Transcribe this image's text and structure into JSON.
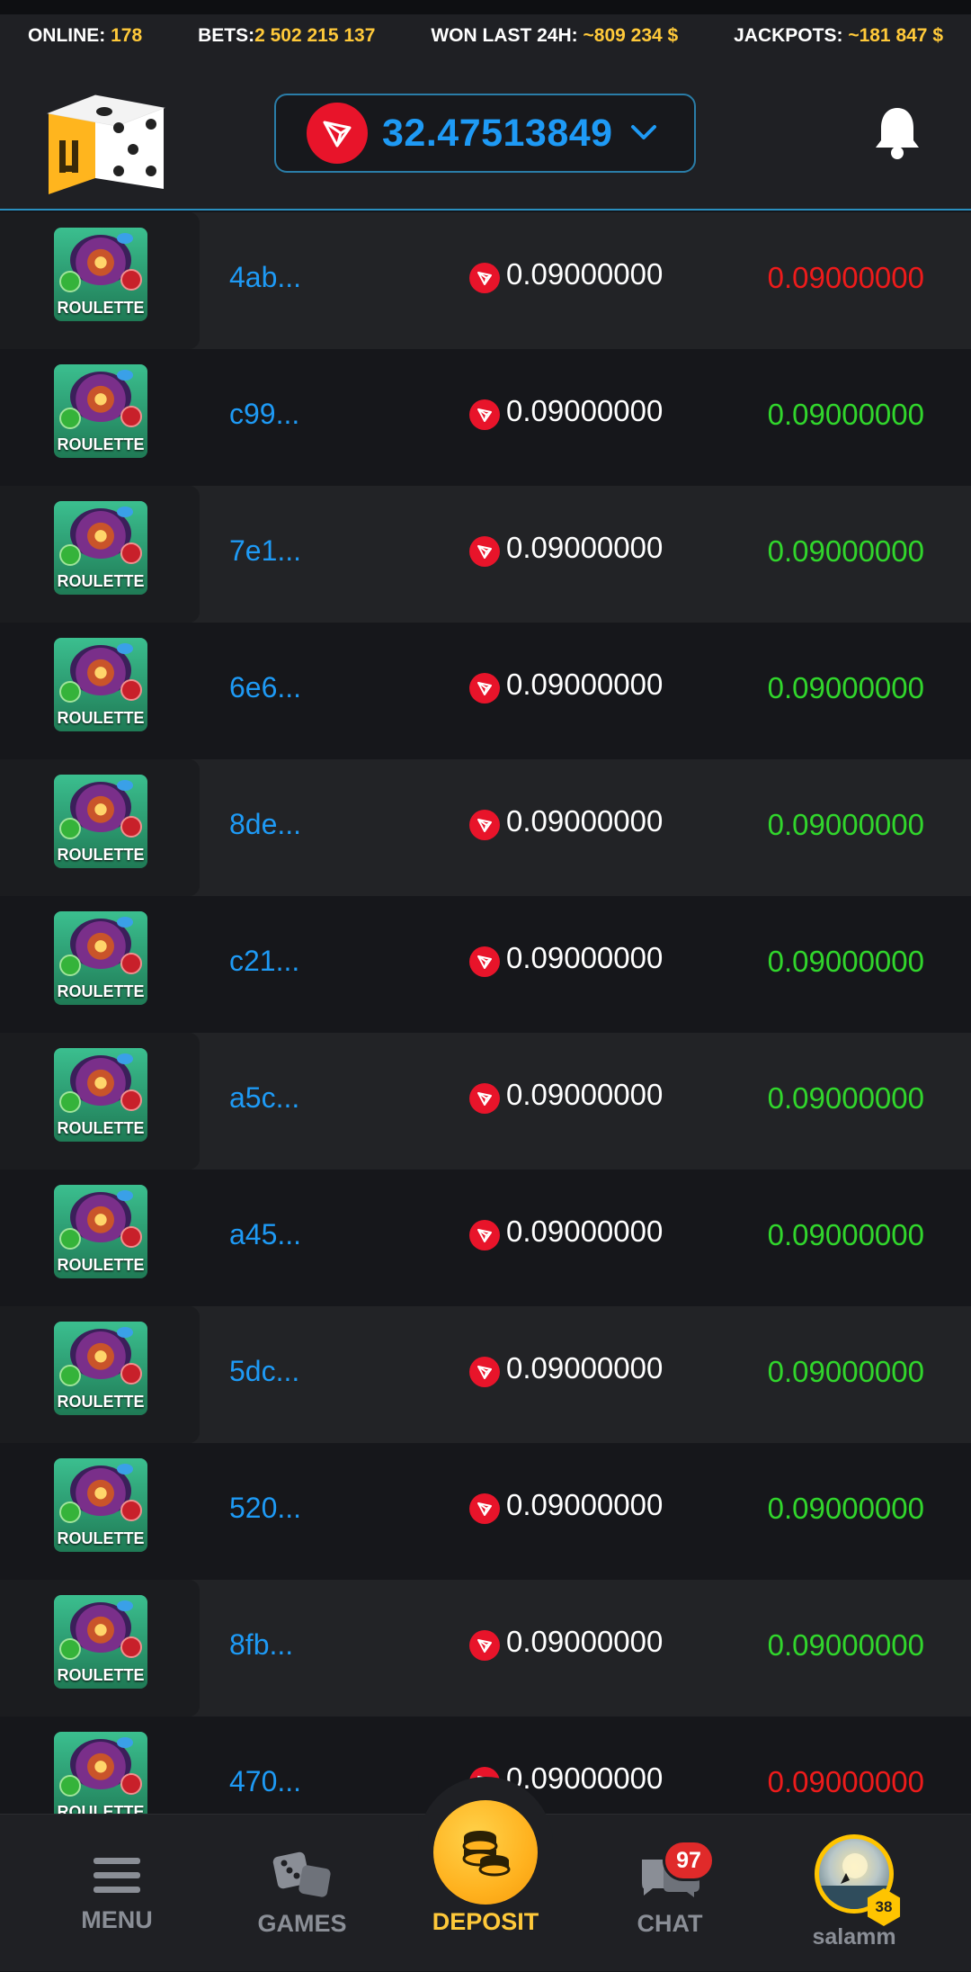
{
  "ticker": {
    "online_label": "ONLINE:",
    "online_value": "178",
    "bets_label": "BETS:",
    "bets_value": "2 502 215 137",
    "won_label": "WON LAST 24H:",
    "won_value": "~809 234 $",
    "jackpots_label": "JACKPOTS:",
    "jackpots_value": "~181 847 $"
  },
  "header": {
    "logo_icon": "dice-logo-icon",
    "balance": "32.47513849",
    "currency_icon": "tron-icon",
    "notification_icon": "bell-icon"
  },
  "bets": [
    {
      "game": "ROULETTE",
      "hash": "4ab...",
      "amount": "0.09000000",
      "profit": "0.09000000",
      "result": "loss"
    },
    {
      "game": "ROULETTE",
      "hash": "c99...",
      "amount": "0.09000000",
      "profit": "0.09000000",
      "result": "win"
    },
    {
      "game": "ROULETTE",
      "hash": "7e1...",
      "amount": "0.09000000",
      "profit": "0.09000000",
      "result": "win"
    },
    {
      "game": "ROULETTE",
      "hash": "6e6...",
      "amount": "0.09000000",
      "profit": "0.09000000",
      "result": "win"
    },
    {
      "game": "ROULETTE",
      "hash": "8de...",
      "amount": "0.09000000",
      "profit": "0.09000000",
      "result": "win"
    },
    {
      "game": "ROULETTE",
      "hash": "c21...",
      "amount": "0.09000000",
      "profit": "0.09000000",
      "result": "win"
    },
    {
      "game": "ROULETTE",
      "hash": "a5c...",
      "amount": "0.09000000",
      "profit": "0.09000000",
      "result": "win"
    },
    {
      "game": "ROULETTE",
      "hash": "a45...",
      "amount": "0.09000000",
      "profit": "0.09000000",
      "result": "win"
    },
    {
      "game": "ROULETTE",
      "hash": "5dc...",
      "amount": "0.09000000",
      "profit": "0.09000000",
      "result": "win"
    },
    {
      "game": "ROULETTE",
      "hash": "520...",
      "amount": "0.09000000",
      "profit": "0.09000000",
      "result": "win"
    },
    {
      "game": "ROULETTE",
      "hash": "8fb...",
      "amount": "0.09000000",
      "profit": "0.09000000",
      "result": "win"
    },
    {
      "game": "ROULETTE",
      "hash": "470...",
      "amount": "0.09000000",
      "profit": "0.09000000",
      "result": "loss"
    }
  ],
  "colors": {
    "accent_blue": "#1e9af5",
    "win_green": "#31d62c",
    "loss_red": "#ee1b1b",
    "gold": "#ffc93a",
    "tron_red": "#e8142a"
  },
  "nav": {
    "menu_label": "MENU",
    "games_label": "GAMES",
    "deposit_label": "DEPOSIT",
    "chat_label": "CHAT",
    "chat_badge": "97",
    "username": "salamm",
    "level": "38"
  }
}
